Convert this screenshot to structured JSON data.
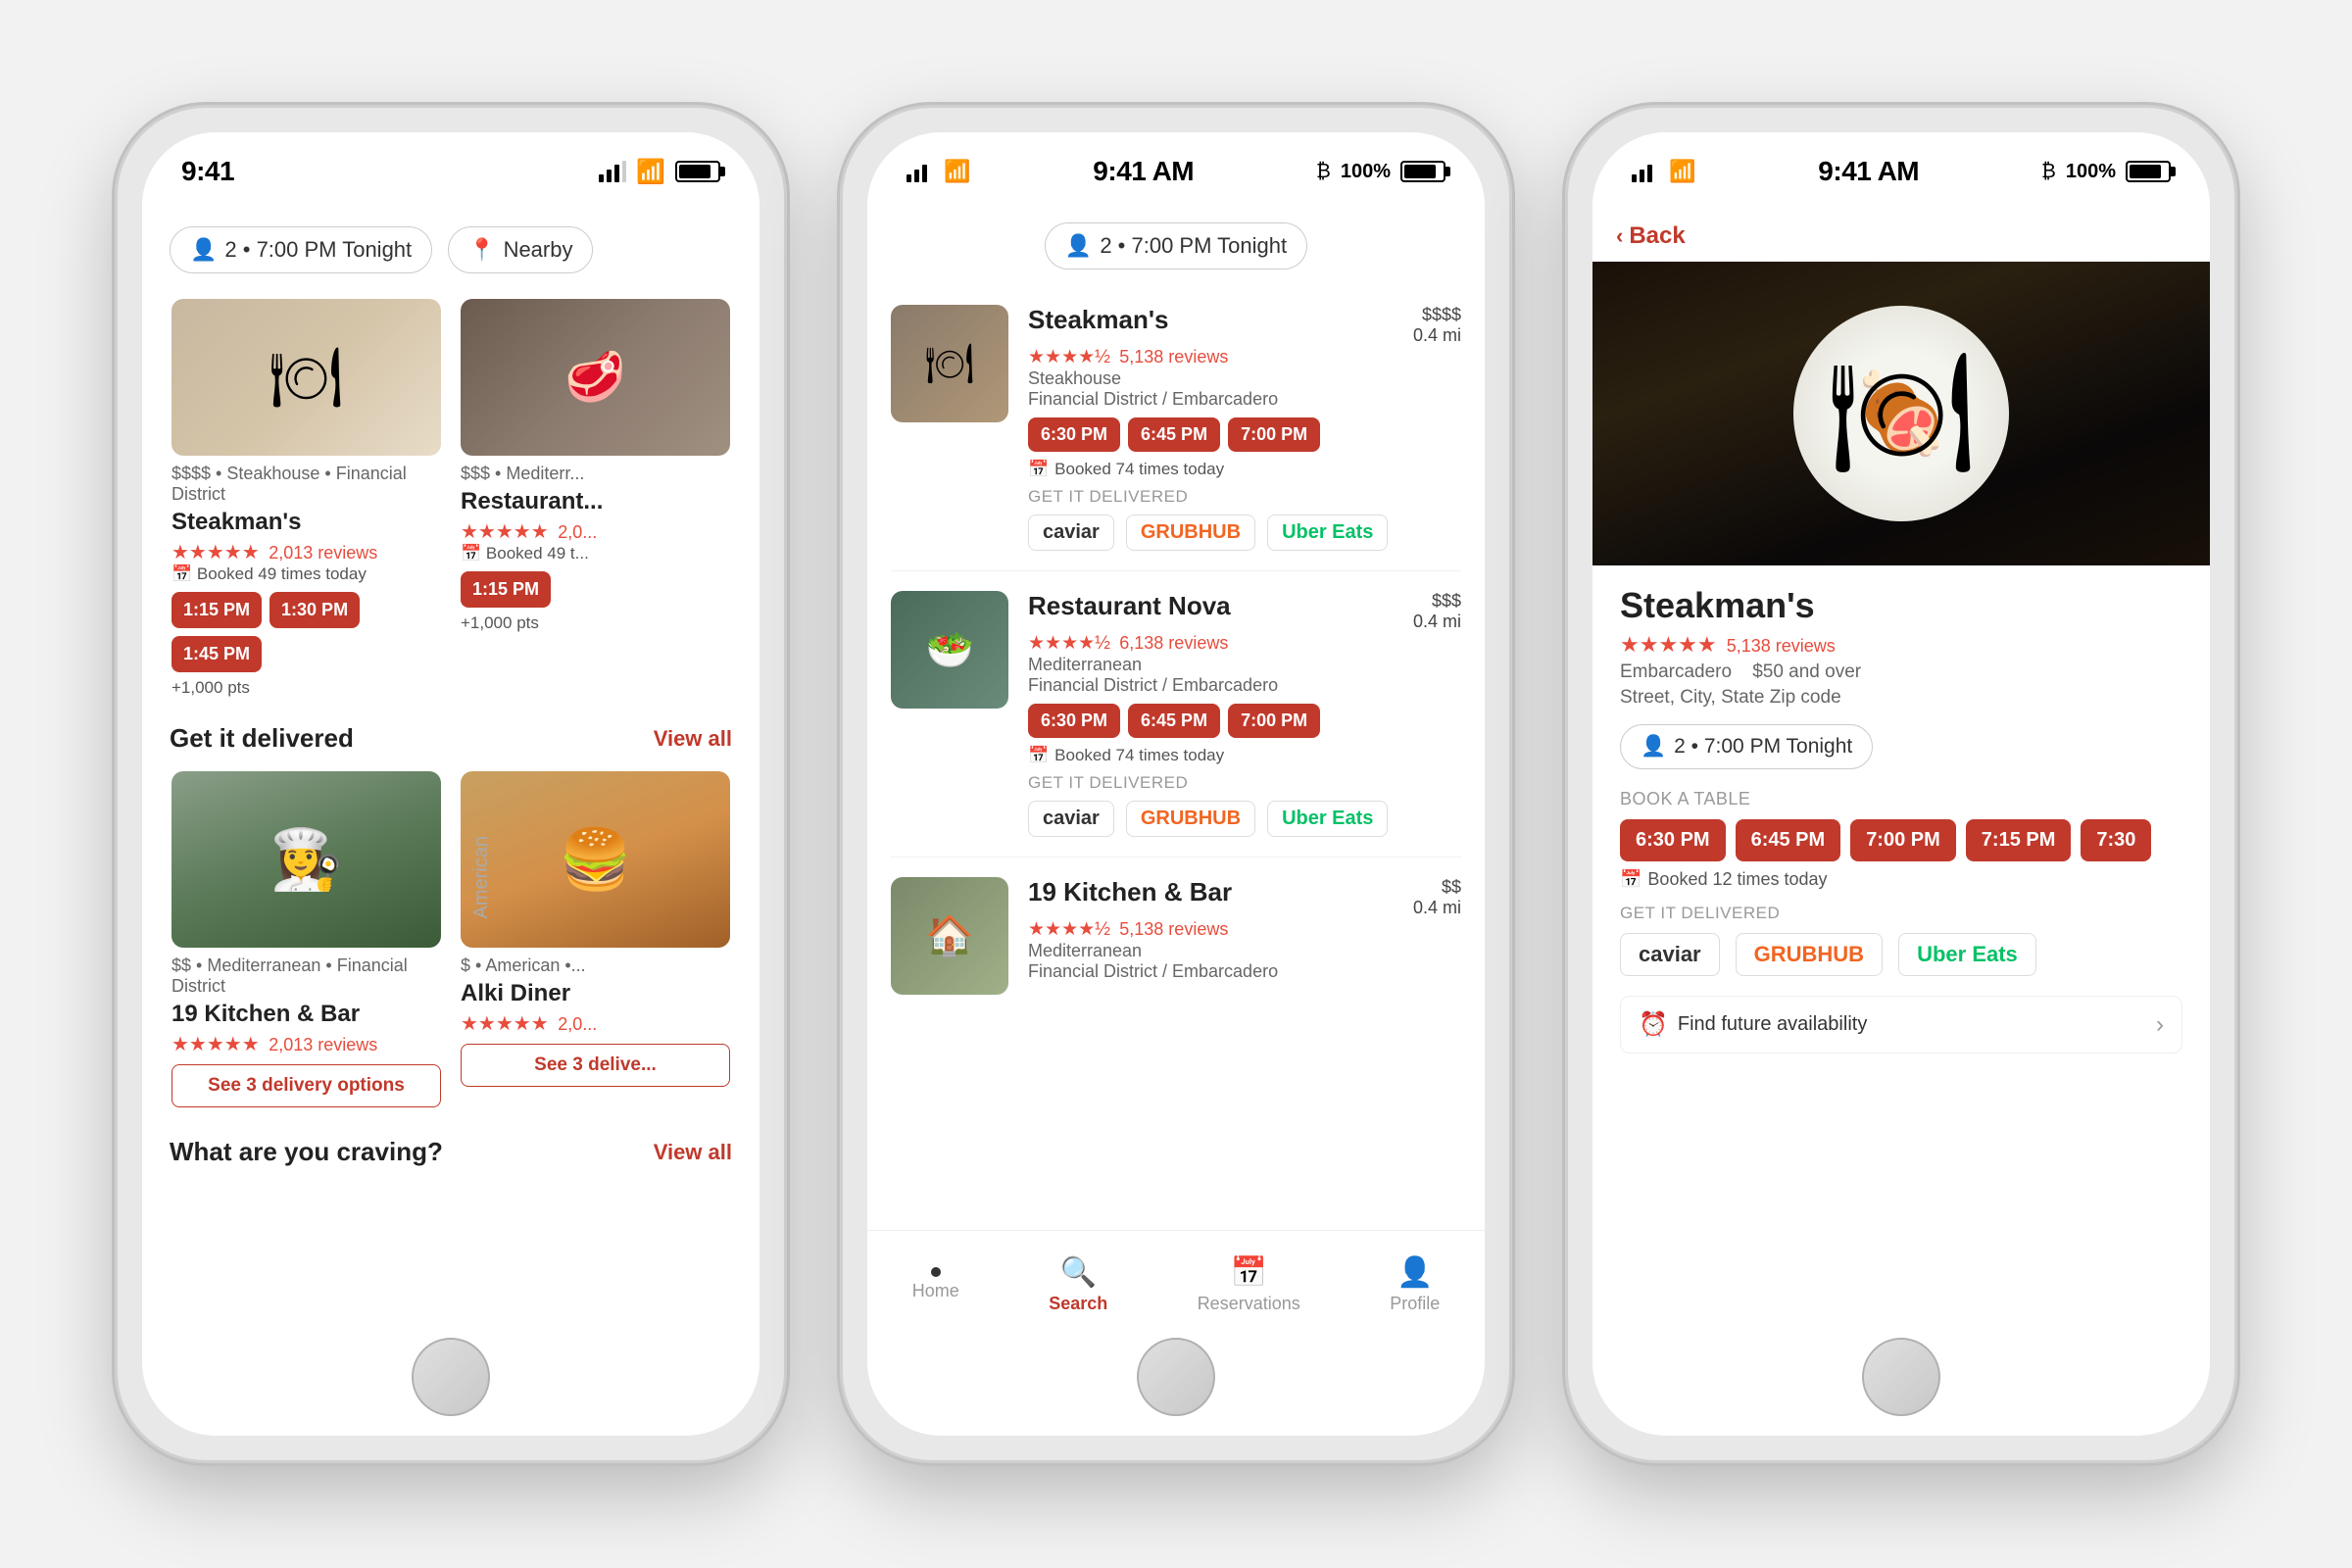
{
  "scene": {
    "background": "#f2f2f2"
  },
  "phone1": {
    "status": {
      "time": "9:41",
      "battery_full": true
    },
    "filter": {
      "guests_label": "2 • 7:00 PM Tonight",
      "location_label": "Nearby"
    },
    "restaurants": [
      {
        "meta": "$$$$  •  Steakhouse  •  Financial District",
        "name": "Steakman's",
        "stars": "★★★★★",
        "reviews": "2,013 reviews",
        "booked": "Booked 49 times today",
        "slots": [
          "1:15 PM",
          "1:30 PM",
          "1:45 PM"
        ],
        "points": "+1,000 pts"
      },
      {
        "meta": "$$$  •  Mediterr...",
        "name": "Restaurant...",
        "stars": "★★★★★",
        "reviews": "2,0...",
        "booked": "Booked 49 t...",
        "slots": [
          "1:15 PM"
        ],
        "points": "+1,000 pts"
      }
    ],
    "delivery_section": {
      "title": "Get it delivered",
      "link": "View all"
    },
    "delivery_restaurants": [
      {
        "meta": "$$  •  Mediterranean  •  Financial District",
        "name": "19 Kitchen & Bar",
        "stars": "★★★★★",
        "reviews": "2,013 reviews",
        "delivery_btn": "See 3 delivery options"
      },
      {
        "meta": "$  •  American  •...",
        "name": "Alki Diner",
        "stars": "★★★★★",
        "reviews": "2,0...",
        "delivery_btn": "See 3 delive..."
      }
    ],
    "craving_section": {
      "title": "What are you craving?",
      "link": "View all"
    }
  },
  "phone2": {
    "status": {
      "time": "9:41 AM",
      "battery": "100%",
      "bluetooth": true
    },
    "filter": {
      "guests_label": "2 • 7:00 PM Tonight"
    },
    "restaurants": [
      {
        "name": "Steakman's",
        "stars": "★★★★½",
        "reviews": "5,138 reviews",
        "cuisine": "Steakhouse",
        "location": "Financial District / Embarcadero",
        "price": "$$$$",
        "distance": "0.4 mi",
        "slots": [
          "6:30 PM",
          "6:45 PM",
          "7:00 PM"
        ],
        "booked": "Booked 74 times today",
        "delivery_label": "GET IT DELIVERED",
        "delivery": [
          "caviar",
          "GRUBHUB",
          "Uber Eats"
        ]
      },
      {
        "name": "Restaurant Nova",
        "stars": "★★★★½",
        "reviews": "6,138 reviews",
        "cuisine": "Mediterranean",
        "location": "Financial District / Embarcadero",
        "price": "$$$",
        "distance": "0.4 mi",
        "slots": [
          "6:30 PM",
          "6:45 PM",
          "7:00 PM"
        ],
        "booked": "Booked 74 times today",
        "delivery_label": "GET IT DELIVERED",
        "delivery": [
          "caviar",
          "GRUBHUB",
          "Uber Eats"
        ]
      },
      {
        "name": "19 Kitchen & Bar",
        "stars": "★★★★½",
        "reviews": "5,138 reviews",
        "cuisine": "Mediterranean",
        "location": "Financial District / Embarcadero",
        "price": "$$",
        "distance": "0.4 mi",
        "slots": [],
        "booked": "",
        "delivery_label": "",
        "delivery": []
      }
    ],
    "nav": {
      "items": [
        {
          "label": "Home",
          "icon": "home",
          "active": false
        },
        {
          "label": "Search",
          "icon": "search",
          "active": true
        },
        {
          "label": "Reservations",
          "icon": "calendar",
          "active": false
        },
        {
          "label": "Profile",
          "icon": "person",
          "active": false
        }
      ]
    }
  },
  "phone3": {
    "status": {
      "time": "9:41 AM",
      "battery": "100%",
      "bluetooth": true
    },
    "back_label": "Back",
    "restaurant": {
      "name": "Steakman's",
      "stars": "★★★★★",
      "reviews": "5,138 reviews",
      "location": "Embarcadero",
      "price": "$50 and over",
      "address": "Street, City, State Zip code"
    },
    "filter": {
      "guests_label": "2 • 7:00 PM Tonight"
    },
    "book_label": "BOOK A TABLE",
    "slots": [
      "6:30 PM",
      "6:45 PM",
      "7:00 PM",
      "7:15 PM",
      "7:30"
    ],
    "booked": "Booked 12 times today",
    "delivery_label": "GET IT DELIVERED",
    "delivery": [
      "caviar",
      "GRUBHUB",
      "Uber Eats"
    ],
    "find_avail": "Find future availability"
  }
}
